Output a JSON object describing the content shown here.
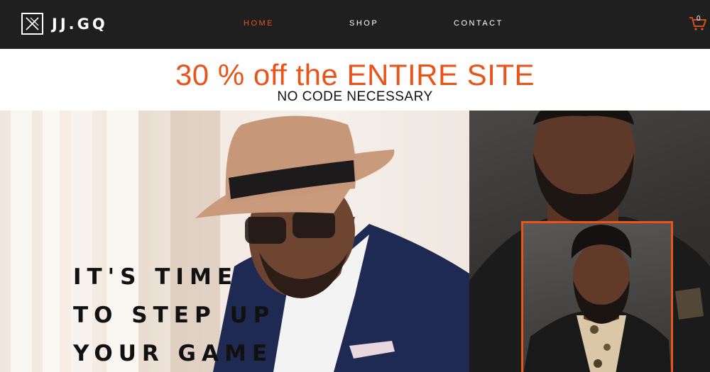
{
  "header": {
    "brand": "JJ.GQ",
    "nav": [
      {
        "label": "HOME",
        "active": true
      },
      {
        "label": "SHOP",
        "active": false
      },
      {
        "label": "CONTACT",
        "active": false
      }
    ],
    "cart_count": "0",
    "cart_icon": "cart-icon",
    "logo_icon": "monogram-logo-icon"
  },
  "promo": {
    "title": "30 % off the ENTIRE SITE",
    "subtitle": "NO CODE NECESSARY"
  },
  "hero": {
    "tagline": [
      "IT'S TIME",
      "TO STEP UP",
      "YOUR GAME"
    ],
    "left_image": "man-in-fedora-and-blazer-photo",
    "right_image": "bearded-man-portrait-photo",
    "inset_image": "bearded-man-inset-portrait-photo"
  },
  "colors": {
    "accent": "#e8541a",
    "header_bg": "#1f1f1f",
    "text_dark": "#111111"
  }
}
